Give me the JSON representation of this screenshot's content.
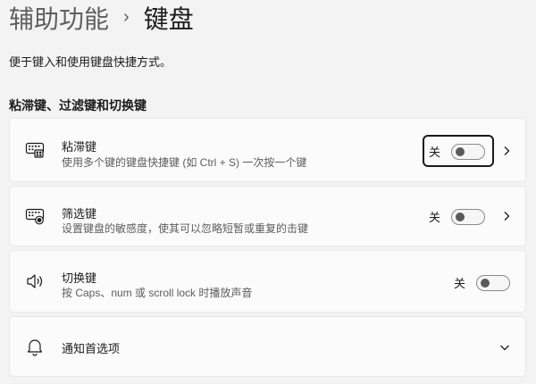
{
  "breadcrumb": {
    "parent": "辅助功能",
    "separator": "›",
    "current": "键盘"
  },
  "description": "便于键入和使用键盘快捷方式。",
  "section_title": "粘滞键、过滤键和切换键",
  "settings": [
    {
      "title": "粘滞键",
      "subtitle": "使用多个键的键盘快捷键 (如 Ctrl + S) 一次按一个键",
      "state": "关",
      "icon": "sticky-keys-icon"
    },
    {
      "title": "筛选键",
      "subtitle": "设置键盘的敏感度，使其可以忽略短暂或重复的击键",
      "state": "关",
      "icon": "filter-keys-icon"
    },
    {
      "title": "切换键",
      "subtitle": "按 Caps、num 或 scroll lock 时播放声音",
      "state": "关",
      "icon": "toggle-keys-speaker-icon"
    },
    {
      "title": "通知首选项",
      "icon": "bell-icon"
    }
  ],
  "colors": {
    "background": "#f3f3f3",
    "card": "#fbfbfb",
    "text": "#1b1b1b",
    "secondary_text": "#5d5d5d"
  }
}
